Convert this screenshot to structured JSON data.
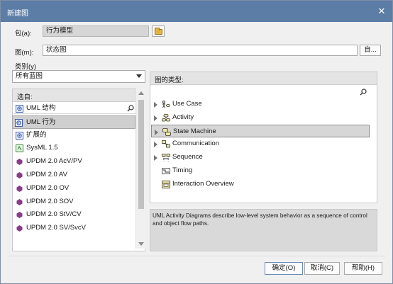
{
  "window": {
    "title": "新建图",
    "close_glyph": "✕"
  },
  "package": {
    "label": "包(a):",
    "value": "行为模型"
  },
  "diagram": {
    "label": "图(m):",
    "value": "状态图",
    "button": "自..."
  },
  "category": {
    "label": "类别(y)",
    "selected": "所有蓝图"
  },
  "left_panel": {
    "header": "选自:",
    "items": [
      {
        "label": "UML 结构",
        "icon": "uml-icon"
      },
      {
        "label": "UML 行为",
        "icon": "uml-icon"
      },
      {
        "label": "扩展的",
        "icon": "uml-icon"
      },
      {
        "label": "SysML 1.5",
        "icon": "sysml-icon"
      },
      {
        "label": "UPDM 2.0 AcV/PV",
        "icon": "updm-icon"
      },
      {
        "label": "UPDM 2.0 AV",
        "icon": "updm-icon"
      },
      {
        "label": "UPDM 2.0 OV",
        "icon": "updm-icon"
      },
      {
        "label": "UPDM 2.0 SOV",
        "icon": "updm-icon"
      },
      {
        "label": "UPDM 2.0 StV/CV",
        "icon": "updm-icon"
      },
      {
        "label": "UPDM 2.0 SV/SvcV",
        "icon": "updm-icon"
      }
    ],
    "selected_index": 1
  },
  "right_panel": {
    "header": "图的类型:",
    "types": [
      {
        "label": "Use Case",
        "icon": "use-case-icon",
        "expander": true
      },
      {
        "label": "Activity",
        "icon": "activity-icon",
        "expander": true
      },
      {
        "label": "State Machine",
        "icon": "state-machine-icon",
        "expander": true
      },
      {
        "label": "Communication",
        "icon": "communication-icon",
        "expander": true
      },
      {
        "label": "Sequence",
        "icon": "sequence-icon",
        "expander": true
      },
      {
        "label": "Timing",
        "icon": "timing-icon",
        "expander": false
      },
      {
        "label": "Interaction Overview",
        "icon": "interaction-overview-icon",
        "expander": false
      }
    ],
    "selected_index": 2
  },
  "description": "UML Activity Diagrams describe low-level system behavior as a sequence of control and object flow paths.",
  "buttons": {
    "ok": "确定(O)",
    "cancel": "取消(C)",
    "help": "帮助(H)"
  },
  "colors": {
    "titlebar": "#5c7da6",
    "selection": "#cfcfcf",
    "uml_icon": "#3d5fb0",
    "updm_icon": "#8a3a8a",
    "sysml_icon": "#3c8a3c"
  }
}
